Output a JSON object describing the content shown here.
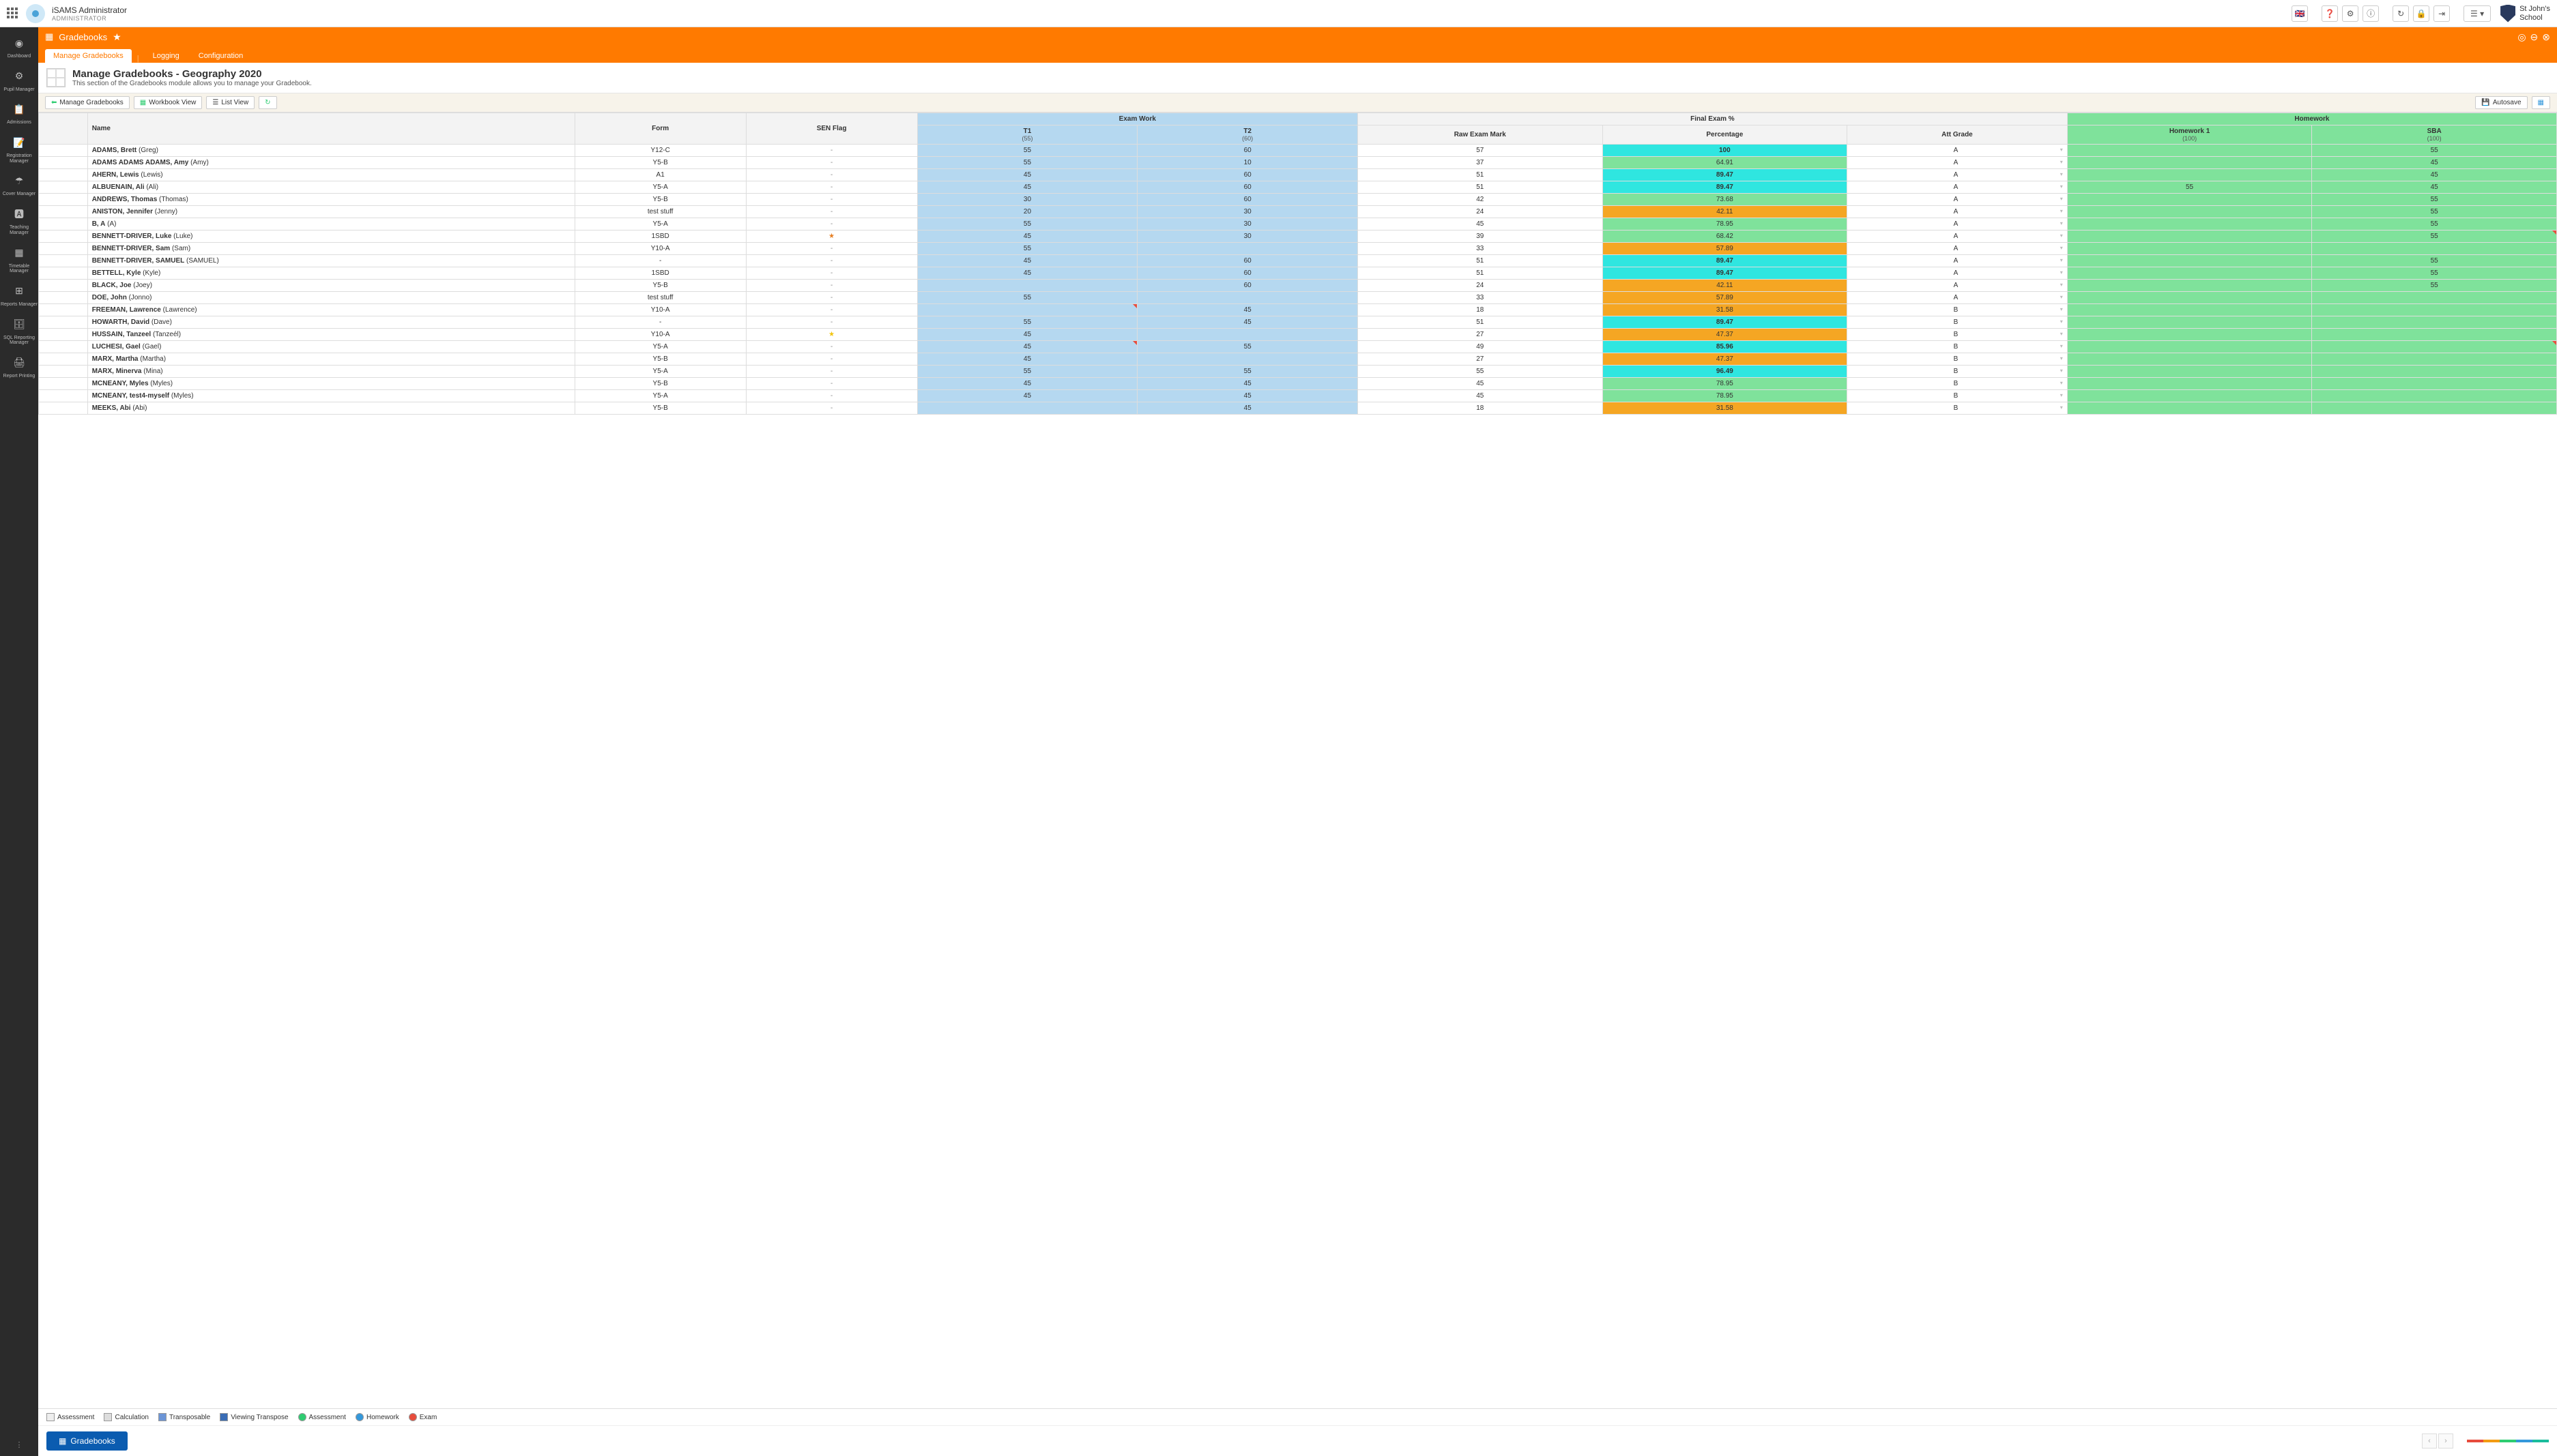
{
  "header": {
    "user_name": "iSAMS Administrator",
    "user_role": "ADMINISTRATOR",
    "school_line1": "St John's",
    "school_line2": "School"
  },
  "sidebar": {
    "items": [
      {
        "label": "Dashboard"
      },
      {
        "label": "Pupil Manager"
      },
      {
        "label": "Admissions"
      },
      {
        "label": "Registration Manager"
      },
      {
        "label": "Cover Manager"
      },
      {
        "label": "Teaching Manager"
      },
      {
        "label": "Timetable Manager"
      },
      {
        "label": "Reports Manager"
      },
      {
        "label": "SQL Reporting Manager"
      },
      {
        "label": "Report Printing"
      }
    ]
  },
  "module": {
    "title": "Gradebooks",
    "tabs": [
      "Manage Gradebooks",
      "Logging",
      "Configuration"
    ],
    "page_title": "Manage Gradebooks - Geography 2020",
    "page_subtitle": "This section of the Gradebooks module allows you to manage your Gradebook."
  },
  "toolbar": {
    "btn_manage": "Manage Gradebooks",
    "btn_workbook": "Workbook View",
    "btn_list": "List View",
    "btn_autosave": "Autosave"
  },
  "columns": {
    "group_exam": "Exam Work",
    "group_final": "Final Exam %",
    "group_hw": "Homework",
    "name": "Name",
    "form": "Form",
    "sen": "SEN Flag",
    "t1": "T1",
    "t1_max": "(55)",
    "t2": "T2",
    "t2_max": "(60)",
    "raw": "Raw Exam Mark",
    "pct": "Percentage",
    "att": "Att Grade",
    "hw1": "Homework 1",
    "hw1_max": "(100)",
    "sba": "SBA",
    "sba_max": "(100)"
  },
  "rows": [
    {
      "name": "ADAMS, Brett (Greg)",
      "form": "Y12-C",
      "sen": "-",
      "t1": "55",
      "t2": "60",
      "raw": "57",
      "pct": "100",
      "pct_c": "pc-cyan",
      "att": "A",
      "hw1": "",
      "sba": "55"
    },
    {
      "name": "ADAMS ADAMS ADAMS, Amy (Amy)",
      "form": "Y5-B",
      "sen": "-",
      "t1": "55",
      "t2": "10",
      "raw": "37",
      "pct": "64.91",
      "pct_c": "pc-green",
      "att": "A",
      "hw1": "",
      "sba": "45"
    },
    {
      "name": "AHERN, Lewis (Lewis)",
      "form": "A1",
      "sen": "-",
      "t1": "45",
      "t2": "60",
      "raw": "51",
      "pct": "89.47",
      "pct_c": "pc-cyan",
      "att": "A",
      "hw1": "",
      "sba": "45"
    },
    {
      "name": "ALBUENAIN, Ali (Ali)",
      "form": "Y5-A",
      "sen": "-",
      "t1": "45",
      "t2": "60",
      "raw": "51",
      "pct": "89.47",
      "pct_c": "pc-cyan",
      "att": "A",
      "hw1": "55",
      "sba": "45"
    },
    {
      "name": "ANDREWS, Thomas (Thomas)",
      "form": "Y5-B",
      "sen": "-",
      "t1": "30",
      "t2": "60",
      "raw": "42",
      "pct": "73.68",
      "pct_c": "pc-green",
      "att": "A",
      "hw1": "",
      "sba": "55"
    },
    {
      "name": "ANISTON, Jennifer (Jenny)",
      "form": "test stuff",
      "sen": "-",
      "t1": "20",
      "t2": "30",
      "raw": "24",
      "pct": "42.11",
      "pct_c": "pc-orange",
      "att": "A",
      "hw1": "",
      "sba": "55"
    },
    {
      "name": "B, A (A)",
      "form": "Y5-A",
      "sen": "-",
      "t1": "55",
      "t2": "30",
      "raw": "45",
      "pct": "78.95",
      "pct_c": "pc-green",
      "att": "A",
      "hw1": "",
      "sba": "55"
    },
    {
      "name": "BENNETT-DRIVER, Luke (Luke)",
      "form": "1SBD",
      "sen": "star",
      "t1": "45",
      "t2": "30",
      "raw": "39",
      "pct": "68.42",
      "pct_c": "pc-green",
      "att": "A",
      "hw1": "",
      "sba": "55",
      "tri": true
    },
    {
      "name": "BENNETT-DRIVER, Sam (Sam)",
      "form": "Y10-A",
      "sen": "-",
      "t1": "55",
      "t2": "",
      "raw": "33",
      "pct": "57.89",
      "pct_c": "pc-orange",
      "att": "A",
      "hw1": "",
      "sba": ""
    },
    {
      "name": "BENNETT-DRIVER, SAMUEL (SAMUEL)",
      "form": "-",
      "sen": "-",
      "t1": "45",
      "t2": "60",
      "raw": "51",
      "pct": "89.47",
      "pct_c": "pc-cyan",
      "att": "A",
      "hw1": "",
      "sba": "55"
    },
    {
      "name": "BETTELL, Kyle (Kyle)",
      "form": "1SBD",
      "sen": "-",
      "t1": "45",
      "t2": "60",
      "raw": "51",
      "pct": "89.47",
      "pct_c": "pc-cyan",
      "att": "A",
      "hw1": "",
      "sba": "55"
    },
    {
      "name": "BLACK, Joe (Joey)",
      "form": "Y5-B",
      "sen": "-",
      "t1": "",
      "t2": "60",
      "raw": "24",
      "pct": "42.11",
      "pct_c": "pc-orange",
      "att": "A",
      "hw1": "",
      "sba": "55"
    },
    {
      "name": "DOE, John (Jonno)",
      "form": "test stuff",
      "sen": "-",
      "t1": "55",
      "t2": "",
      "raw": "33",
      "pct": "57.89",
      "pct_c": "pc-orange",
      "att": "A",
      "hw1": "",
      "sba": ""
    },
    {
      "name": "FREEMAN, Lawrence (Lawrence)",
      "form": "Y10-A",
      "sen": "-",
      "t1": "",
      "t2": "45",
      "raw": "18",
      "pct": "31.58",
      "pct_c": "pc-orange",
      "att": "B",
      "hw1": "",
      "sba": "",
      "redtri_t1": true
    },
    {
      "name": "HOWARTH, David (Dave)",
      "form": "-",
      "sen": "-",
      "t1": "55",
      "t2": "45",
      "raw": "51",
      "pct": "89.47",
      "pct_c": "pc-cyan",
      "att": "B",
      "hw1": "",
      "sba": ""
    },
    {
      "name": "HUSSAIN, Tanzeel (Tanzeél)",
      "form": "Y10-A",
      "sen": "ystar",
      "t1": "45",
      "t2": "",
      "raw": "27",
      "pct": "47.37",
      "pct_c": "pc-orange",
      "att": "B",
      "hw1": "",
      "sba": ""
    },
    {
      "name": "LUCHESI, Gael (Gael)",
      "form": "Y5-A",
      "sen": "-",
      "t1": "45",
      "t2": "55",
      "raw": "49",
      "pct": "85.96",
      "pct_c": "pc-cyan",
      "att": "B",
      "hw1": "",
      "sba": "",
      "redtri_t1": true,
      "tri": true
    },
    {
      "name": "MARX, Martha (Martha)",
      "form": "Y5-B",
      "sen": "-",
      "t1": "45",
      "t2": "",
      "raw": "27",
      "pct": "47.37",
      "pct_c": "pc-orange",
      "att": "B",
      "hw1": "",
      "sba": ""
    },
    {
      "name": "MARX, Minerva (Mina)",
      "form": "Y5-A",
      "sen": "-",
      "t1": "55",
      "t2": "55",
      "raw": "55",
      "pct": "96.49",
      "pct_c": "pc-cyan",
      "att": "B",
      "hw1": "",
      "sba": ""
    },
    {
      "name": "MCNEANY, Myles (Myles)",
      "form": "Y5-B",
      "sen": "-",
      "t1": "45",
      "t2": "45",
      "raw": "45",
      "pct": "78.95",
      "pct_c": "pc-green",
      "att": "B",
      "hw1": "",
      "sba": ""
    },
    {
      "name": "MCNEANY, test4-myself (Myles)",
      "form": "Y5-A",
      "sen": "-",
      "t1": "45",
      "t2": "45",
      "raw": "45",
      "pct": "78.95",
      "pct_c": "pc-green",
      "att": "B",
      "hw1": "",
      "sba": ""
    },
    {
      "name": "MEEKS, Abi (Abi)",
      "form": "Y5-B",
      "sen": "-",
      "t1": "",
      "t2": "45",
      "raw": "18",
      "pct": "31.58",
      "pct_c": "pc-orange",
      "att": "B",
      "hw1": "",
      "sba": ""
    }
  ],
  "legend": {
    "assessment": "Assessment",
    "calculation": "Calculation",
    "transposable": "Transposable",
    "viewing_transpose": "Viewing Transpose",
    "assessment2": "Assessment",
    "homework": "Homework",
    "exam": "Exam"
  },
  "bottom": {
    "gradebooks_btn": "Gradebooks"
  }
}
